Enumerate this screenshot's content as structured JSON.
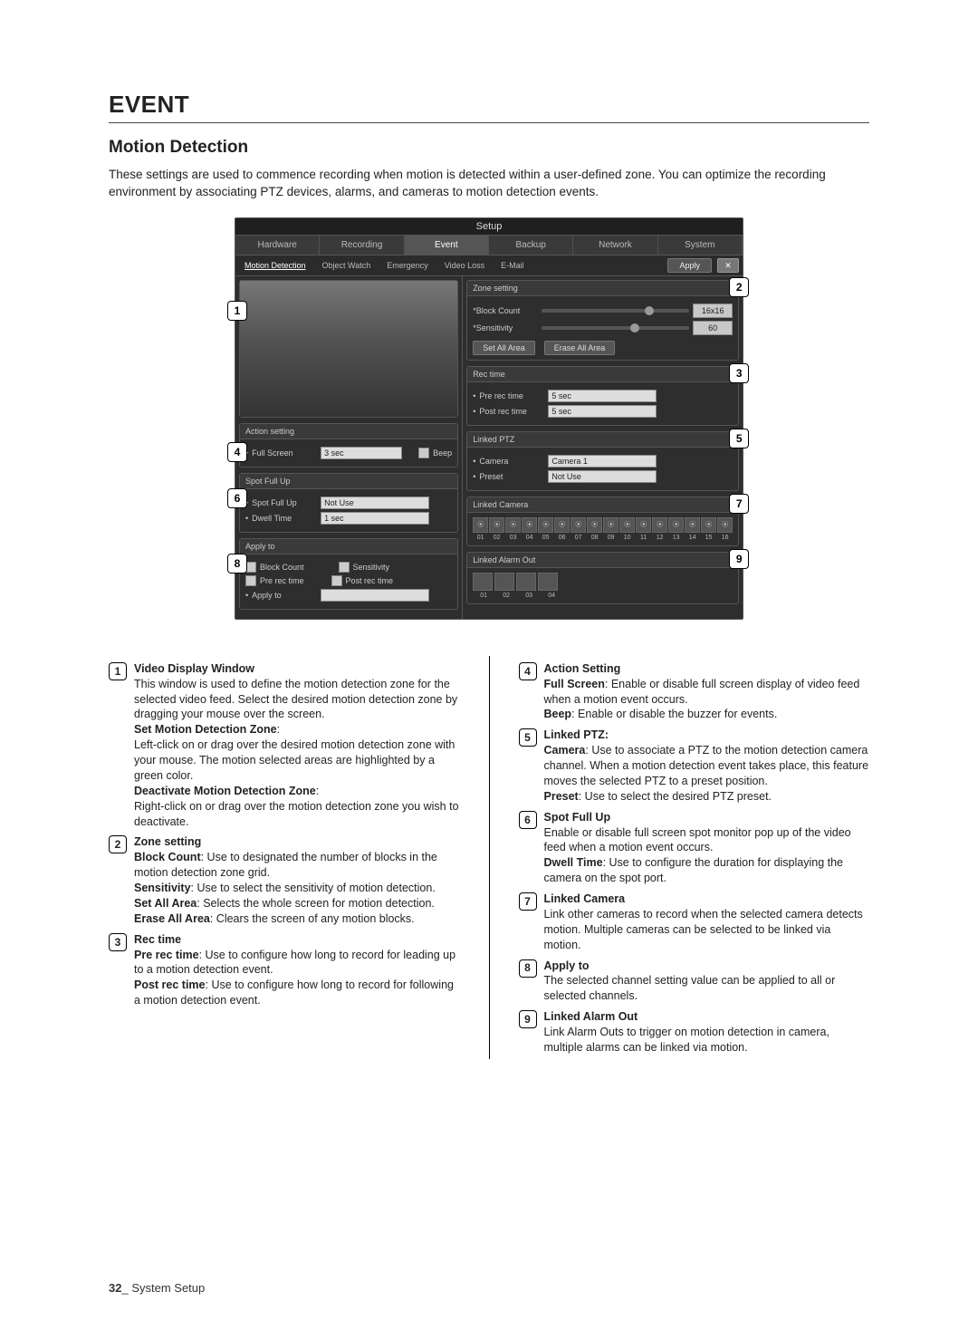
{
  "heading": "EVENT",
  "subheading": "Motion Detection",
  "intro": "These settings are used to commence recording when motion is detected within a user-defined zone. You can optimize the recording environment by associating PTZ devices, alarms, and cameras to motion detection events.",
  "shot": {
    "title": "Setup",
    "tabs": [
      "Hardware",
      "Recording",
      "Event",
      "Backup",
      "Network",
      "System"
    ],
    "tabs_active": 2,
    "subtabs_left": [
      "Motion Detection",
      "Object Watch",
      "Emergency"
    ],
    "subtabs_right": [
      "Video Loss",
      "E-Mail"
    ],
    "apply": "Apply",
    "panels": {
      "action_setting": {
        "title": "Action setting",
        "full_screen": "Full Screen",
        "full_screen_val": "3 sec",
        "beep": "Beep"
      },
      "spot_full_up": {
        "title": "Spot Full Up",
        "spot_label": "Spot Full Up",
        "spot_val": "Not Use",
        "dwell_label": "Dwell Time",
        "dwell_val": "1 sec"
      },
      "apply_to": {
        "title": "Apply to",
        "block_count": "Block Count",
        "sensitivity": "Sensitivity",
        "pre_rec": "Pre rec time",
        "post_rec": "Post rec time",
        "apply_label": "Apply to"
      },
      "zone_setting": {
        "title": "Zone setting",
        "block_label": "*Block Count",
        "block_val": "16x16",
        "sens_label": "*Sensitivity",
        "sens_val": "60",
        "set_all": "Set All Area",
        "erase_all": "Erase All Area"
      },
      "rec_time": {
        "title": "Rec time",
        "pre_label": "Pre rec time",
        "pre_val": "5 sec",
        "post_label": "Post rec time",
        "post_val": "5 sec"
      },
      "linked_ptz": {
        "title": "Linked PTZ",
        "camera_label": "Camera",
        "camera_val": "Camera 1",
        "preset_label": "Preset",
        "preset_val": "Not Use"
      },
      "linked_camera": {
        "title": "Linked Camera",
        "labels": [
          "01",
          "02",
          "03",
          "04",
          "05",
          "06",
          "07",
          "08",
          "09",
          "10",
          "11",
          "12",
          "13",
          "14",
          "15",
          "16"
        ]
      },
      "linked_alarm": {
        "title": "Linked Alarm Out",
        "labels": [
          "01",
          "02",
          "03",
          "04"
        ]
      }
    }
  },
  "desc": {
    "d1": {
      "title": "Video Display Window",
      "text": "This window is used to define the motion detection zone for the selected video feed. Select the desired motion detection zone by dragging your mouse over the screen.",
      "set_title": "Set Motion Detection Zone",
      "set_text": "Left-click on or drag over the desired motion detection zone with your mouse. The motion selected areas are highlighted by a green color.",
      "deact_title": "Deactivate Motion Detection Zone",
      "deact_text": "Right-click on or drag over the motion detection zone you wish to deactivate."
    },
    "d2": {
      "title": "Zone setting",
      "block_b": "Block Count",
      "block": ": Use to designated the number of blocks in the motion detection zone grid.",
      "sens_b": "Sensitivity",
      "sens": ": Use to select the sensitivity of motion detection.",
      "set_b": "Set All Area",
      "set": ": Selects the whole screen for motion detection.",
      "erase_b": "Erase All Area",
      "erase": ": Clears the screen of any motion blocks."
    },
    "d3": {
      "title": "Rec time",
      "pre_b": "Pre rec time",
      "pre": ": Use to configure how long to record for leading up to a motion detection event.",
      "post_b": "Post rec time",
      "post": ": Use to configure how long to record for following a motion detection event."
    },
    "d4": {
      "title": "Action Setting",
      "full_b": "Full Screen",
      "full": ": Enable or disable full screen display of video feed when a motion event occurs.",
      "beep_b": "Beep",
      "beep": ": Enable or disable the buzzer for events."
    },
    "d5": {
      "title": "Linked PTZ:",
      "cam_b": "Camera",
      "cam": ": Use to associate a PTZ to the motion detection camera channel. When a motion detection event takes place, this feature moves the selected PTZ to a preset position.",
      "preset_b": "Preset",
      "preset": ": Use to select the desired PTZ preset."
    },
    "d6": {
      "title": "Spot Full Up",
      "text": "Enable or disable full screen spot monitor pop up of the video feed when a motion event occurs.",
      "dwell_b": "Dwell Time",
      "dwell": ": Use to configure the duration for displaying the camera on the spot port."
    },
    "d7": {
      "title": "Linked Camera",
      "text": "Link other cameras to record when the selected camera detects motion. Multiple cameras can be selected to be linked via motion."
    },
    "d8": {
      "title": "Apply to",
      "text": "The selected channel setting value can be applied to all or selected channels."
    },
    "d9": {
      "title": "Linked Alarm Out",
      "text": "Link Alarm Outs to trigger on motion detection in camera, multiple alarms can be linked via motion."
    }
  },
  "footer_page": "32",
  "footer_text": " System Setup"
}
